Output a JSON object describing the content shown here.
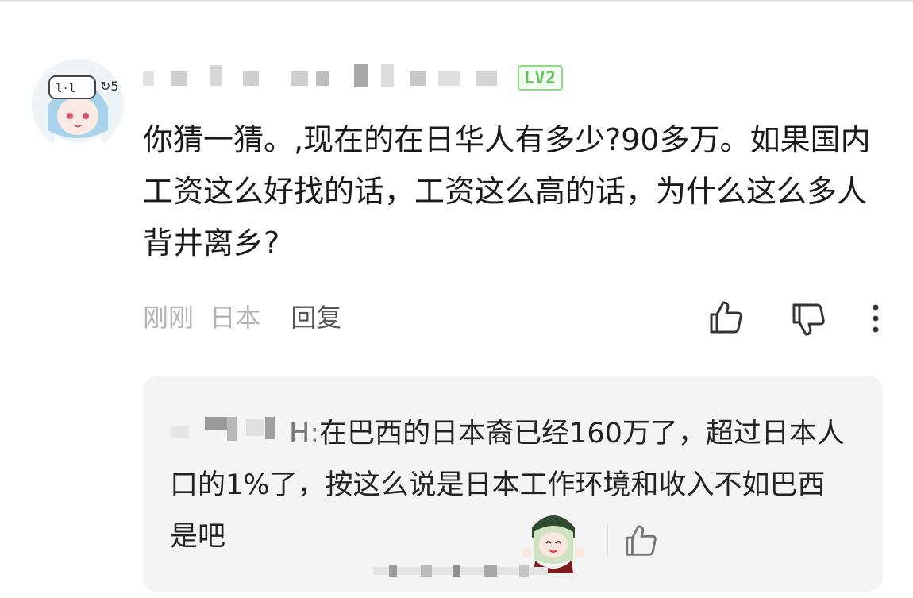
{
  "comment": {
    "level_badge": "LV2",
    "text": "你猜一猜。,现在的在日华人有多少?90多万。如果国内工资这么好找的话，工资这么高的话，为什么这么多人背井离乡?",
    "time": "刚刚",
    "location": "日本",
    "reply_label": "回复",
    "icons": {
      "like": "thumbs-up-icon",
      "dislike": "thumbs-down-icon",
      "more": "more-vertical-icon"
    }
  },
  "reply": {
    "name_suffix": "H:",
    "text": "在巴西的日本裔已经160万了，超过日本人口的1%了，按这么说是日本工作环境和收入不如巴西是吧",
    "icons": {
      "like": "thumbs-up-icon",
      "sticker": "sticker-emoji"
    }
  },
  "colors": {
    "level_green": "#63c15c",
    "reply_bg": "#f4f4f5",
    "meta_gray": "#b3b3b3"
  }
}
